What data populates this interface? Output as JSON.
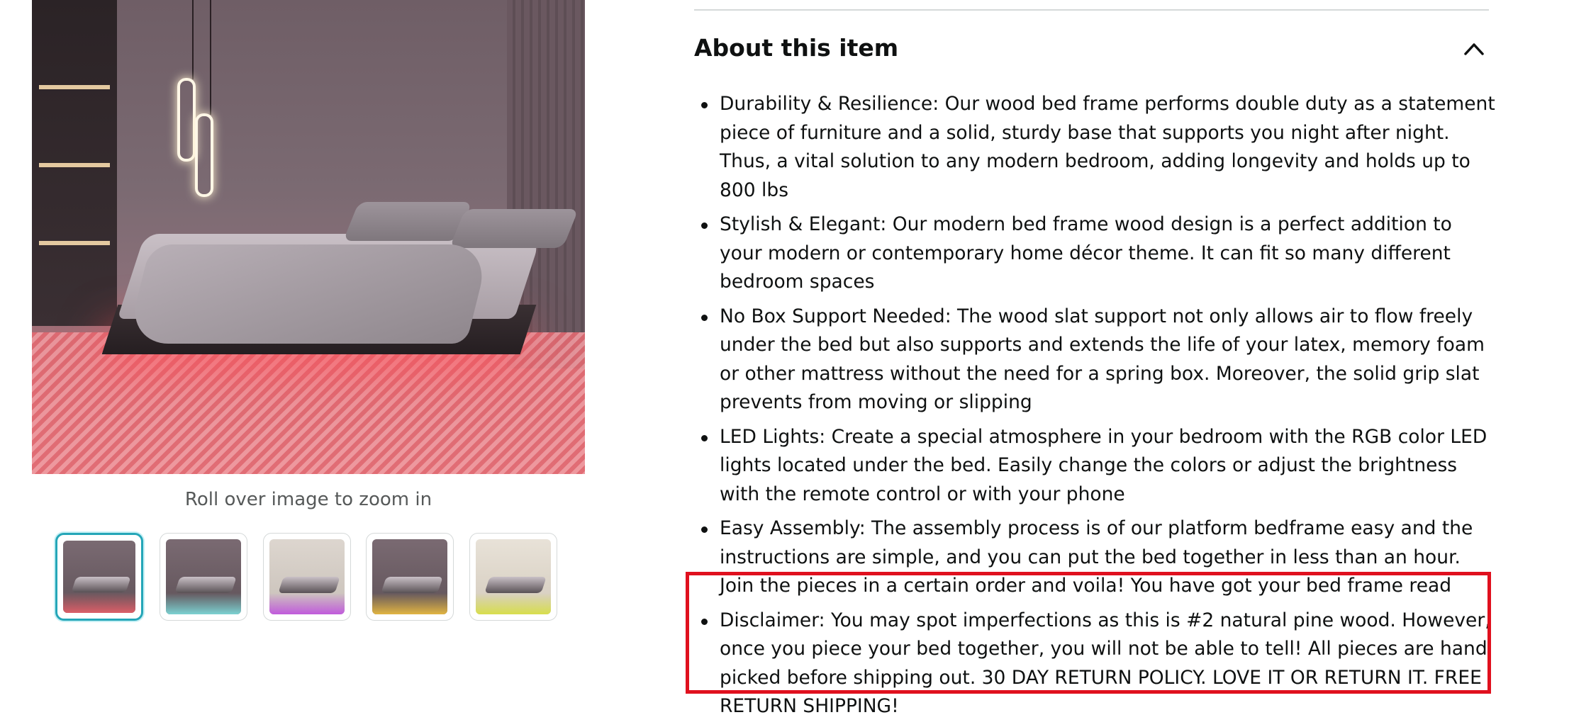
{
  "gallery": {
    "zoom_hint": "Roll over image to zoom in",
    "thumbnails": [
      {
        "label": "thumbnail-1",
        "glow": "#e9606a",
        "selected": true
      },
      {
        "label": "thumbnail-2",
        "glow": "#7fe0e0",
        "selected": false
      },
      {
        "label": "thumbnail-3",
        "glow": "#c050e0",
        "selected": false
      },
      {
        "label": "thumbnail-4",
        "glow": "#f0c040",
        "selected": false
      },
      {
        "label": "thumbnail-5",
        "glow": "#d8e040",
        "selected": false
      }
    ]
  },
  "about": {
    "title": "About this item",
    "chevron_icon": "chevron-up-icon",
    "bullets": [
      "Durability & Resilience: Our wood bed frame performs double duty as a statement piece of furniture and a solid, sturdy base that supports you night after night. Thus, a vital solution to any modern bedroom, adding longevity and holds up to 800 lbs",
      "Stylish & Elegant: Our modern bed frame wood design is a perfect addition to your modern or contemporary home décor theme. It can fit so many different bedroom spaces",
      "No Box Support Needed: The wood slat support not only allows air to flow freely under the bed but also supports and extends the life of your latex, memory foam or other mattress without the need for a spring box. Moreover, the solid grip slat prevents from moving or slipping",
      "LED Lights: Create a special atmosphere in your bedroom with the RGB color LED lights located under the bed. Easily change the colors or adjust the brightness with the remote control or with your phone",
      "Easy Assembly: The assembly process is of our platform bedframe easy and the instructions are simple, and you can put the bed together in less than an hour. Join the pieces in a certain order and voila! You have got your bed frame read",
      "Disclaimer: You may spot imperfections as this is #2 natural pine wood. However, once you piece your bed together, you will not be able to tell! All pieces are hand picked before shipping out. 30 DAY RETURN POLICY. LOVE IT OR RETURN IT. FREE RETURN SHIPPING!"
    ]
  },
  "colors": {
    "highlight": "#e0101e",
    "selected_thumb_border": "#25a6b8"
  }
}
